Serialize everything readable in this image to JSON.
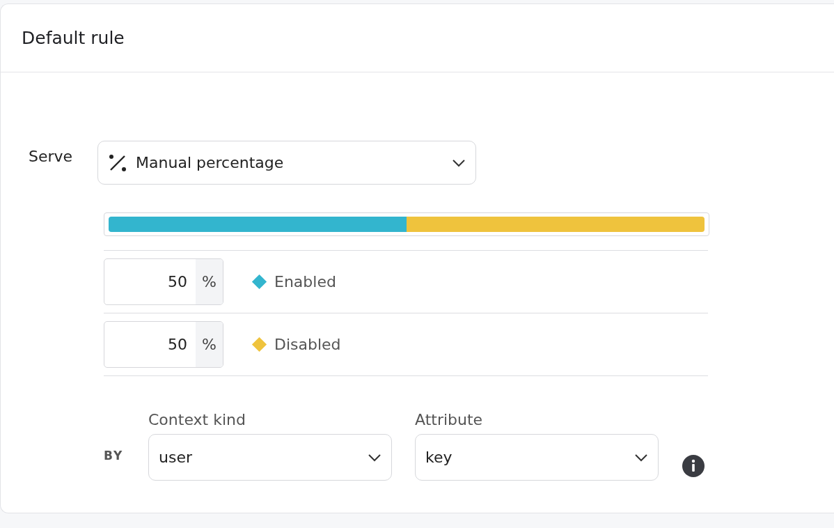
{
  "card": {
    "title": "Default rule"
  },
  "serve": {
    "label": "Serve",
    "selection": "Manual percentage"
  },
  "variations": [
    {
      "percent": "50",
      "unit": "%",
      "name": "Enabled",
      "color": "#33b5ce"
    },
    {
      "percent": "50",
      "unit": "%",
      "name": "Disabled",
      "color": "#efc33d"
    }
  ],
  "by": {
    "label": "BY",
    "context_kind": {
      "label": "Context kind",
      "value": "user"
    },
    "attribute": {
      "label": "Attribute",
      "value": "key"
    }
  }
}
